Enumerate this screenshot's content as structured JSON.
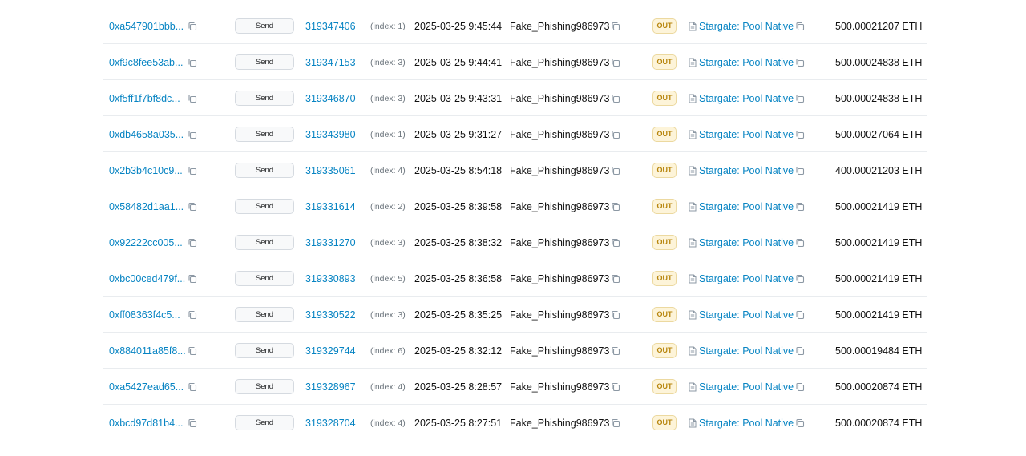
{
  "icons": {
    "copy": "copy-icon",
    "contract": "file-text-icon"
  },
  "colors": {
    "link": "#0784c3",
    "out_badge_bg": "#fdf4d9",
    "out_badge_text": "#b7850d"
  },
  "rows": [
    {
      "hash": "0xa547901bbb...",
      "method": "Send",
      "block": "319347406",
      "index": "(index: 1)",
      "time": "2025-03-25 9:45:44",
      "from": "Fake_Phishing986973",
      "direction": "OUT",
      "to": "Stargate: Pool Native",
      "amount": "500.00021207 ETH"
    },
    {
      "hash": "0xf9c8fee53ab...",
      "method": "Send",
      "block": "319347153",
      "index": "(index: 3)",
      "time": "2025-03-25 9:44:41",
      "from": "Fake_Phishing986973",
      "direction": "OUT",
      "to": "Stargate: Pool Native",
      "amount": "500.00024838 ETH"
    },
    {
      "hash": "0xf5ff1f7bf8dc...",
      "method": "Send",
      "block": "319346870",
      "index": "(index: 3)",
      "time": "2025-03-25 9:43:31",
      "from": "Fake_Phishing986973",
      "direction": "OUT",
      "to": "Stargate: Pool Native",
      "amount": "500.00024838 ETH"
    },
    {
      "hash": "0xdb4658a035...",
      "method": "Send",
      "block": "319343980",
      "index": "(index: 1)",
      "time": "2025-03-25 9:31:27",
      "from": "Fake_Phishing986973",
      "direction": "OUT",
      "to": "Stargate: Pool Native",
      "amount": "500.00027064 ETH"
    },
    {
      "hash": "0x2b3b4c10c9...",
      "method": "Send",
      "block": "319335061",
      "index": "(index: 4)",
      "time": "2025-03-25 8:54:18",
      "from": "Fake_Phishing986973",
      "direction": "OUT",
      "to": "Stargate: Pool Native",
      "amount": "400.00021203 ETH"
    },
    {
      "hash": "0x58482d1aa1...",
      "method": "Send",
      "block": "319331614",
      "index": "(index: 2)",
      "time": "2025-03-25 8:39:58",
      "from": "Fake_Phishing986973",
      "direction": "OUT",
      "to": "Stargate: Pool Native",
      "amount": "500.00021419 ETH"
    },
    {
      "hash": "0x92222cc005...",
      "method": "Send",
      "block": "319331270",
      "index": "(index: 3)",
      "time": "2025-03-25 8:38:32",
      "from": "Fake_Phishing986973",
      "direction": "OUT",
      "to": "Stargate: Pool Native",
      "amount": "500.00021419 ETH"
    },
    {
      "hash": "0xbc00ced479f...",
      "method": "Send",
      "block": "319330893",
      "index": "(index: 5)",
      "time": "2025-03-25 8:36:58",
      "from": "Fake_Phishing986973",
      "direction": "OUT",
      "to": "Stargate: Pool Native",
      "amount": "500.00021419 ETH"
    },
    {
      "hash": "0xff08363f4c5...",
      "method": "Send",
      "block": "319330522",
      "index": "(index: 3)",
      "time": "2025-03-25 8:35:25",
      "from": "Fake_Phishing986973",
      "direction": "OUT",
      "to": "Stargate: Pool Native",
      "amount": "500.00021419 ETH"
    },
    {
      "hash": "0x884011a85f8...",
      "method": "Send",
      "block": "319329744",
      "index": "(index: 6)",
      "time": "2025-03-25 8:32:12",
      "from": "Fake_Phishing986973",
      "direction": "OUT",
      "to": "Stargate: Pool Native",
      "amount": "500.00019484 ETH"
    },
    {
      "hash": "0xa5427ead65...",
      "method": "Send",
      "block": "319328967",
      "index": "(index: 4)",
      "time": "2025-03-25 8:28:57",
      "from": "Fake_Phishing986973",
      "direction": "OUT",
      "to": "Stargate: Pool Native",
      "amount": "500.00020874 ETH"
    },
    {
      "hash": "0xbcd97d81b4...",
      "method": "Send",
      "block": "319328704",
      "index": "(index: 4)",
      "time": "2025-03-25 8:27:51",
      "from": "Fake_Phishing986973",
      "direction": "OUT",
      "to": "Stargate: Pool Native",
      "amount": "500.00020874 ETH"
    }
  ]
}
